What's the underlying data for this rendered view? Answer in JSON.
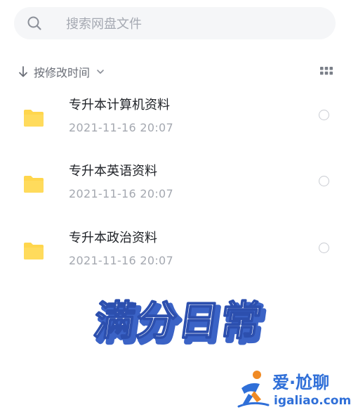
{
  "search": {
    "placeholder": "搜索网盘文件",
    "value": ""
  },
  "sort": {
    "label": "按修改时间",
    "icon": "sort-down-arrow-icon"
  },
  "view_toggle": {
    "icon": "grid-view-icon"
  },
  "files": [
    {
      "name": "专升本计算机资料",
      "date": "2021-11-16  20:07",
      "icon": "folder-icon"
    },
    {
      "name": "专升本英语资料",
      "date": "2021-11-16  20:07",
      "icon": "folder-icon"
    },
    {
      "name": "专升本政治资料",
      "date": "2021-11-16  20:07",
      "icon": "folder-icon"
    }
  ],
  "overlay": {
    "text": "满分日常"
  },
  "logo": {
    "cn": "爱·尬聊",
    "en": "igaliao.com"
  },
  "colors": {
    "folder": "#ffd64d",
    "accent": "#2f6fd8",
    "watermark_fill": "#ffffff",
    "watermark_shadow": "#3b63c6"
  }
}
